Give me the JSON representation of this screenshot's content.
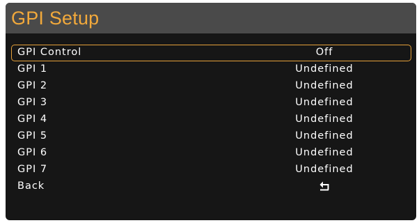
{
  "header": {
    "title": "GPI Setup"
  },
  "menu": {
    "items": [
      {
        "label": "GPI Control",
        "value": "Off",
        "selected": true
      },
      {
        "label": "GPI 1",
        "value": "Undefined"
      },
      {
        "label": "GPI 2",
        "value": "Undefined"
      },
      {
        "label": "GPI 3",
        "value": "Undefined"
      },
      {
        "label": "GPI 4",
        "value": "Undefined"
      },
      {
        "label": "GPI 5",
        "value": "Undefined"
      },
      {
        "label": "GPI 6",
        "value": "Undefined"
      },
      {
        "label": "GPI 7",
        "value": "Undefined"
      }
    ],
    "back": {
      "label": "Back",
      "icon": "back-arrow-icon"
    }
  },
  "colors": {
    "accent": "#e6a13a",
    "title": "#f2a93b",
    "header_bg": "#4a4a4a",
    "panel_bg": "#161616",
    "text": "#ffffff"
  }
}
